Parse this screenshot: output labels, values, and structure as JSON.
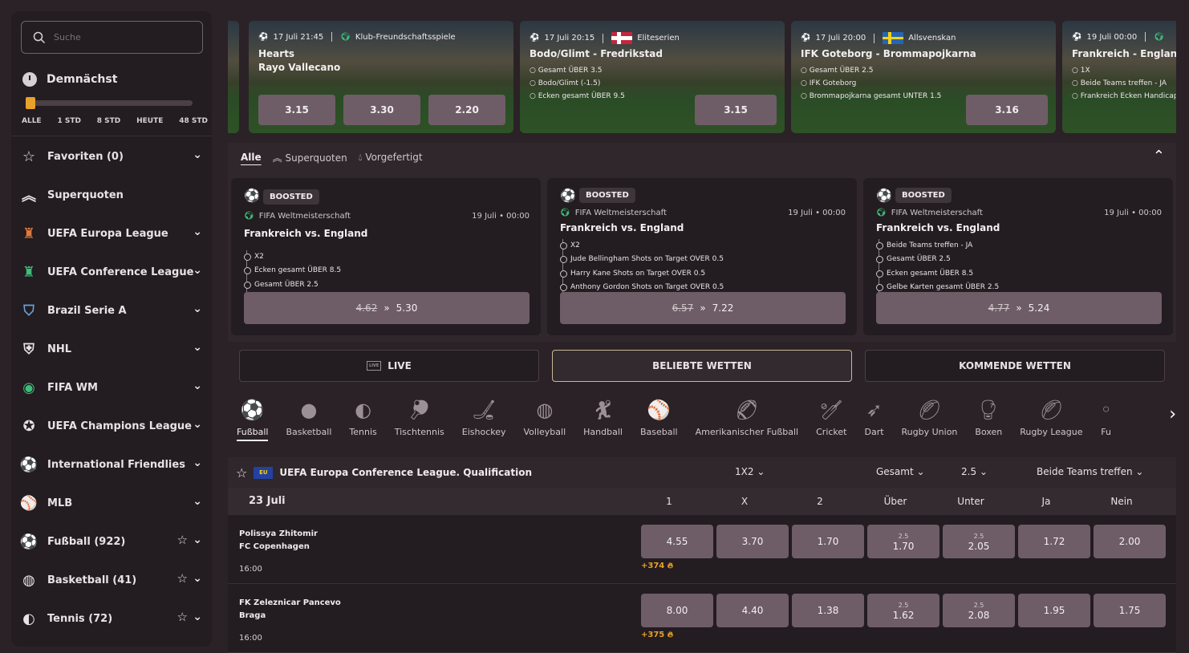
{
  "search": {
    "placeholder": "Suche"
  },
  "upcoming": {
    "title": "Demnächst",
    "filters": [
      "ALLE",
      "1 STD",
      "8 STD",
      "HEUTE",
      "48 STD"
    ],
    "selected_fraction": 0.0
  },
  "sidebar": {
    "items": [
      {
        "label": "Favoriten (0)",
        "icon": "star-icon"
      },
      {
        "label": "Superquoten",
        "icon": "chevron-up-double-icon"
      },
      {
        "label": "UEFA Europa League",
        "icon": "trophy-icon"
      },
      {
        "label": "UEFA Conference League",
        "icon": "trophy-icon"
      },
      {
        "label": "Brazil Serie A",
        "icon": "shield-icon"
      },
      {
        "label": "NHL",
        "icon": "nhl-icon"
      },
      {
        "label": "FIFA WM",
        "icon": "globe-icon"
      },
      {
        "label": "UEFA Champions League",
        "icon": "ball-icon"
      },
      {
        "label": "International Friendlies",
        "icon": "ball-icon"
      },
      {
        "label": "MLB",
        "icon": "baseball-icon"
      },
      {
        "label": "Fußball (922)",
        "icon": "soccer-icon"
      },
      {
        "label": "Basketball (41)",
        "icon": "basketball-icon"
      },
      {
        "label": "Tennis (72)",
        "icon": "tennis-icon"
      }
    ]
  },
  "banner": [
    {
      "date": "17 Juli 21:45",
      "league": "Klub-Freundschaftsspiele",
      "title1": "Hearts",
      "title2": "Rayo Vallecano",
      "lines": [],
      "odds": [
        "3.15",
        "3.30",
        "2.20"
      ]
    },
    {
      "date": "17 Juli 20:15",
      "league": "Eliteserien",
      "title1": "Bodo/Glimt - Fredrikstad",
      "lines": [
        "Gesamt ÜBER 3.5",
        "Bodo/Glimt (-1.5)",
        "Ecken gesamt ÜBER 9.5"
      ],
      "odds": [
        "3.15"
      ]
    },
    {
      "date": "17 Juli 20:00",
      "league": "Allsvenskan",
      "title1": "IFK Goteborg - Brommapojkarna",
      "lines": [
        "Gesamt ÜBER 2.5",
        "IFK Goteborg",
        "Brommapojkarna gesamt UNTER 1.5"
      ],
      "odds": [
        "3.16"
      ]
    },
    {
      "date": "19 Juli 00:00",
      "league": "",
      "title1": "Frankreich - England",
      "lines": [
        "1X",
        "Beide Teams treffen - JA",
        "Frankreich Ecken Handicap"
      ],
      "odds": []
    }
  ],
  "tabs": {
    "all": "Alle",
    "super": "Superquoten",
    "prebuilt": "Vorgefertigt"
  },
  "boosts": [
    {
      "badge": "BOOSTED",
      "league": "FIFA Weltmeisterschaft",
      "date": "19 Juli • 00:00",
      "match": "Frankreich vs. England",
      "legs": [
        "X2",
        "Ecken gesamt ÜBER 8.5",
        "Gesamt ÜBER 2.5"
      ],
      "old": "4.62",
      "new": "5.30"
    },
    {
      "badge": "BOOSTED",
      "league": "FIFA Weltmeisterschaft",
      "date": "19 Juli • 00:00",
      "match": "Frankreich vs. England",
      "legs": [
        "X2",
        "Jude Bellingham Shots on Target OVER 0.5",
        "Harry Kane Shots on Target OVER 0.5",
        "Anthony Gordon Shots on Target OVER 0.5"
      ],
      "old": "6.57",
      "new": "7.22"
    },
    {
      "badge": "BOOSTED",
      "league": "FIFA Weltmeisterschaft",
      "date": "19 Juli • 00:00",
      "match": "Frankreich vs. England",
      "legs": [
        "Beide Teams treffen - JA",
        "Gesamt ÜBER 2.5",
        "Ecken gesamt ÜBER 8.5",
        "Gelbe Karten gesamt ÜBER 2.5"
      ],
      "old": "4.77",
      "new": "5.24"
    }
  ],
  "main_tabs": {
    "live": "LIVE",
    "live_icon": "LIVE",
    "popular": "BELIEBTE WETTEN",
    "upcoming": "KOMMENDE WETTEN"
  },
  "sports": [
    "Fußball",
    "Basketball",
    "Tennis",
    "Tischtennis",
    "Eishockey",
    "Volleyball",
    "Handball",
    "Baseball",
    "Amerikanischer Fußball",
    "Cricket",
    "Dart",
    "Rugby Union",
    "Boxen",
    "Rugby League",
    "Fu"
  ],
  "league_bar": {
    "name": "UEFA Europa Conference League. Qualification",
    "flag_label": "EU",
    "market1": "1X2",
    "market2": "Gesamt",
    "market3": "2.5",
    "market4": "Beide Teams treffen"
  },
  "date_row": {
    "date": "23 Juli",
    "cols": [
      "1",
      "X",
      "2",
      "Über",
      "Unter",
      "Ja",
      "Nein"
    ]
  },
  "matches": [
    {
      "home": "Polissya Zhitomir",
      "away": "FC Copenhagen",
      "time": "16:00",
      "more": "+374",
      "odds": [
        "4.55",
        "3.70",
        "1.70",
        "1.70",
        "2.05",
        "1.72",
        "2.00"
      ],
      "line_over": "2.5",
      "line_under": "2.5"
    },
    {
      "home": "FK Zeleznicar Pancevo",
      "away": "Braga",
      "time": "16:00",
      "more": "+375",
      "odds": [
        "8.00",
        "4.40",
        "1.38",
        "1.62",
        "2.08",
        "1.95",
        "1.75"
      ],
      "line_over": "2.5",
      "line_under": "2.5"
    }
  ],
  "colors": {
    "accent": "#e8a12a",
    "odds_button": "#6e5d67",
    "background": "#2a2226"
  }
}
